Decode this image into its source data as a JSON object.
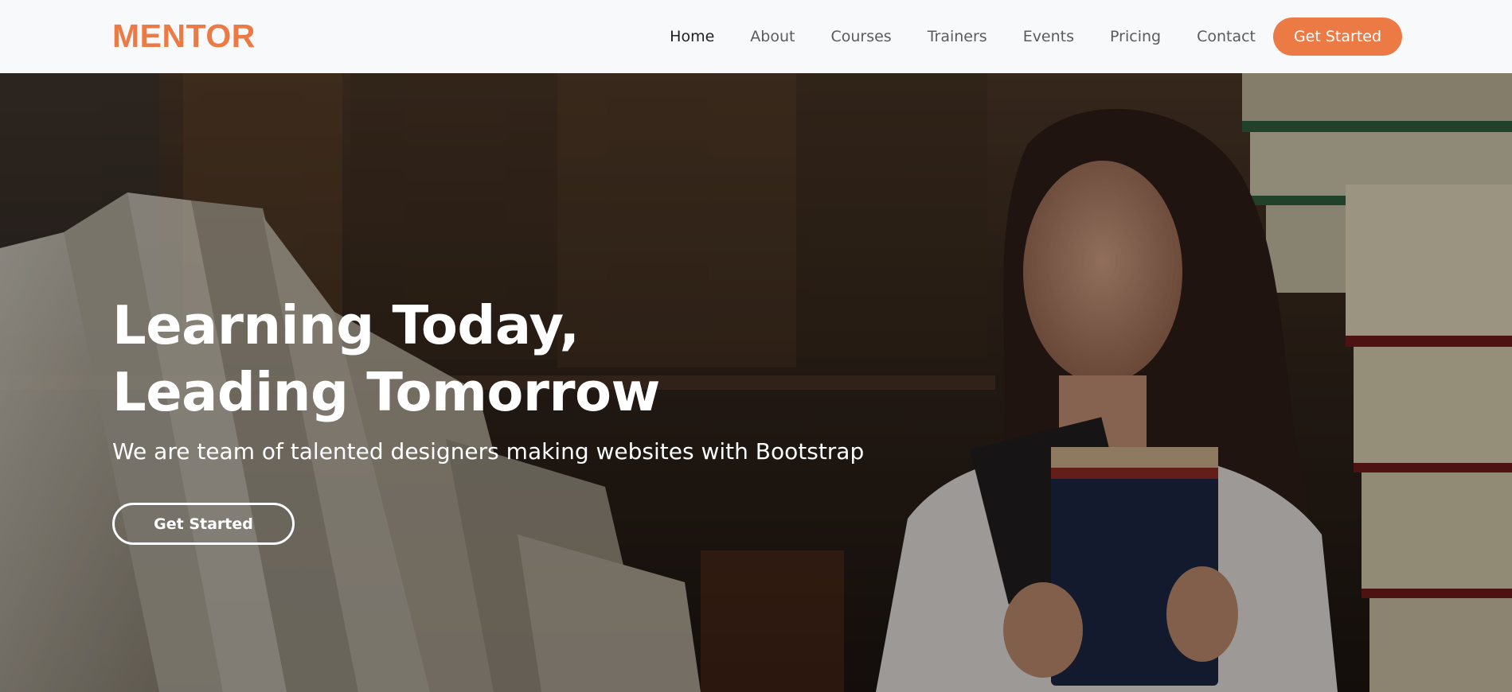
{
  "brand": {
    "name": "MENTOR",
    "color": "#ec7a45"
  },
  "nav": {
    "items": [
      {
        "label": "Home",
        "active": true
      },
      {
        "label": "About"
      },
      {
        "label": "Courses"
      },
      {
        "label": "Trainers"
      },
      {
        "label": "Events"
      },
      {
        "label": "Pricing"
      },
      {
        "label": "Contact"
      }
    ],
    "cta_label": "Get Started"
  },
  "hero": {
    "title_line1": "Learning Today,",
    "title_line2": "Leading Tomorrow",
    "subtitle": "We are team of talented designers making websites with Bootstrap",
    "button_label": "Get Started",
    "image": "photo of a smiling woman holding books, open book and stacked books in library"
  }
}
